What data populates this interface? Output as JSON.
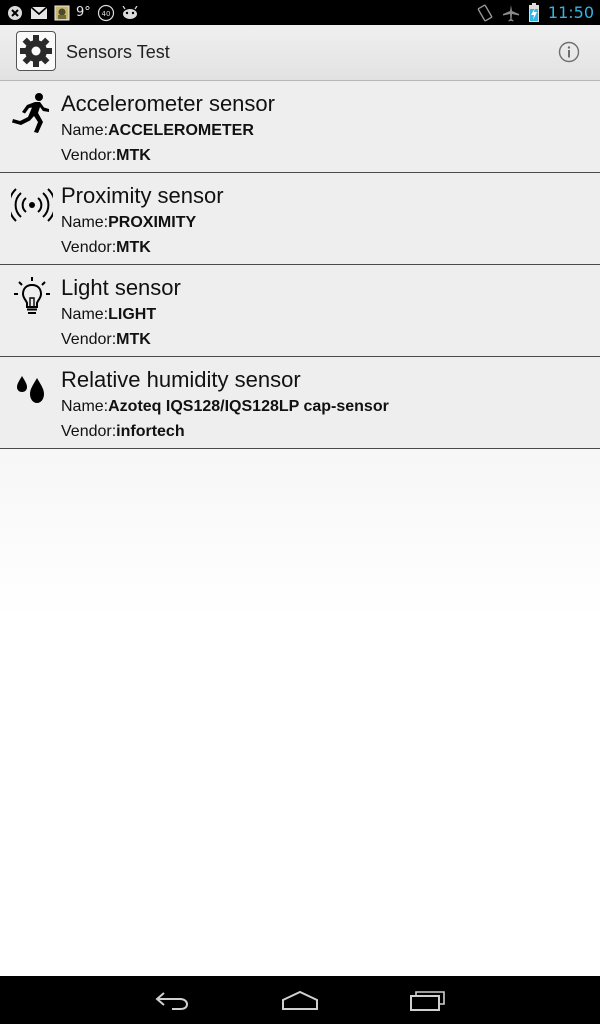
{
  "status_bar": {
    "temperature": "9°",
    "time": "11:50",
    "notification_icons": [
      "close-circle-icon",
      "gmail-icon",
      "gallery-icon",
      "temperature-text",
      "badge-40-icon",
      "android-robot-icon"
    ],
    "system_icons": [
      "rotate-icon",
      "airplane-icon",
      "battery-charging-icon"
    ],
    "clock_color": "#33b5e5"
  },
  "action_bar": {
    "title": "Sensors Test",
    "app_icon": "gear-icon",
    "action_icon": "info-icon"
  },
  "sensors": [
    {
      "title": "Accelerometer sensor",
      "name_label": "Name:",
      "name_value": "ACCELEROMETER",
      "vendor_label": "Vendor:",
      "vendor_value": "MTK",
      "icon": "running-man-icon"
    },
    {
      "title": "Proximity sensor",
      "name_label": "Name:",
      "name_value": "PROXIMITY",
      "vendor_label": "Vendor:",
      "vendor_value": "MTK",
      "icon": "proximity-waves-icon"
    },
    {
      "title": "Light sensor",
      "name_label": "Name:",
      "name_value": "LIGHT",
      "vendor_label": "Vendor:",
      "vendor_value": "MTK",
      "icon": "lightbulb-icon"
    },
    {
      "title": "Relative humidity sensor",
      "name_label": "Name:",
      "name_value": "Azoteq IQS128/IQS128LP cap-sensor",
      "vendor_label": "Vendor:",
      "vendor_value": "infortech",
      "icon": "water-drops-icon"
    }
  ],
  "nav_bar": {
    "buttons": [
      "back-icon",
      "home-icon",
      "recent-apps-icon"
    ]
  }
}
